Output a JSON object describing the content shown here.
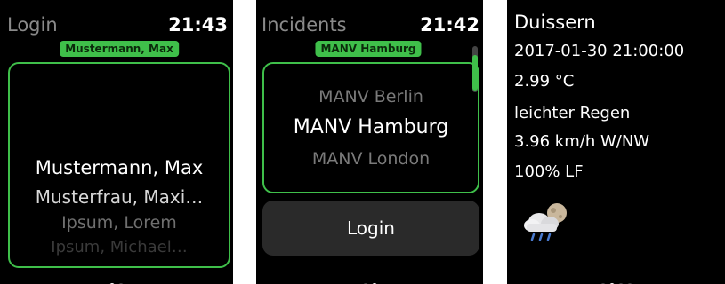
{
  "login_screen": {
    "title": "Login",
    "time": "21:43",
    "selected_badge": "Mustermann, Max",
    "options": [
      "Mustermann, Max",
      "Musterfrau, Maxi…",
      "Ipsum, Lorem",
      "Ipsum, Michael…"
    ],
    "page_dots": {
      "count": 2,
      "active": 0
    }
  },
  "incidents_screen": {
    "title": "Incidents",
    "time": "21:42",
    "selected_badge": "MANV Hamburg",
    "options": [
      "MANV Berlin",
      "MANV Hamburg",
      "MANV London"
    ],
    "login_button_label": "Login",
    "page_dots": {
      "count": 2,
      "active": 1
    }
  },
  "weather_screen": {
    "location": "Duissern",
    "datetime": "2017-01-30 21:00:00",
    "temperature": "2.99 °C",
    "condition": "leichter Regen",
    "wind": "3.96 km/h W/NW",
    "humidity": "100% LF",
    "icon": "rain-cloud-moon-icon",
    "page_dots": {
      "count": 4,
      "active": 1
    }
  },
  "colors": {
    "accent": "#3fbf4a",
    "background": "#000000",
    "button_bg": "#2a2a2a"
  }
}
